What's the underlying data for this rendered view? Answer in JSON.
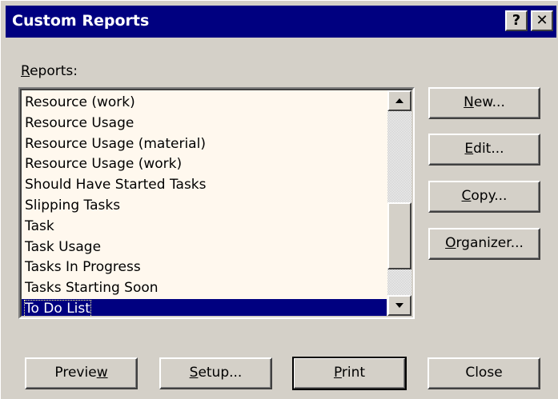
{
  "window": {
    "title": "Custom Reports",
    "help_label": "?",
    "close_label": "✕"
  },
  "reports_label": "Reports:",
  "reports_label_parts": {
    "accel": "R",
    "rest": "eports:"
  },
  "reports": [
    "Resource (work)",
    "Resource Usage",
    "Resource Usage (material)",
    "Resource Usage (work)",
    "Should Have Started Tasks",
    "Slipping Tasks",
    "Task",
    "Task Usage",
    "Tasks In Progress",
    "Tasks Starting Soon",
    "To Do List"
  ],
  "selected_report": "To Do List",
  "side_buttons": {
    "new": {
      "label": "New...",
      "pre": "",
      "accel": "N",
      "post": "ew..."
    },
    "edit": {
      "label": "Edit...",
      "pre": "",
      "accel": "E",
      "post": "dit..."
    },
    "copy": {
      "label": "Copy...",
      "pre": "",
      "accel": "C",
      "post": "opy..."
    },
    "organizer": {
      "label": "Organizer...",
      "pre": "",
      "accel": "O",
      "post": "rganizer..."
    }
  },
  "bottom_buttons": {
    "preview": {
      "label": "Preview",
      "pre": "Previe",
      "accel": "w",
      "post": ""
    },
    "setup": {
      "label": "Setup...",
      "pre": "",
      "accel": "S",
      "post": "etup..."
    },
    "print": {
      "label": "Print",
      "pre": "",
      "accel": "P",
      "post": "rint"
    },
    "close": {
      "label": "Close",
      "pre": "Close",
      "accel": "",
      "post": ""
    }
  },
  "colors": {
    "title_bar": "#000080",
    "dialog_face": "#d4d0c8",
    "list_background": "#fff8ee",
    "selection": "#000080"
  },
  "icons": {
    "scroll_up": "up-arrow-icon",
    "scroll_down": "down-arrow-icon"
  }
}
